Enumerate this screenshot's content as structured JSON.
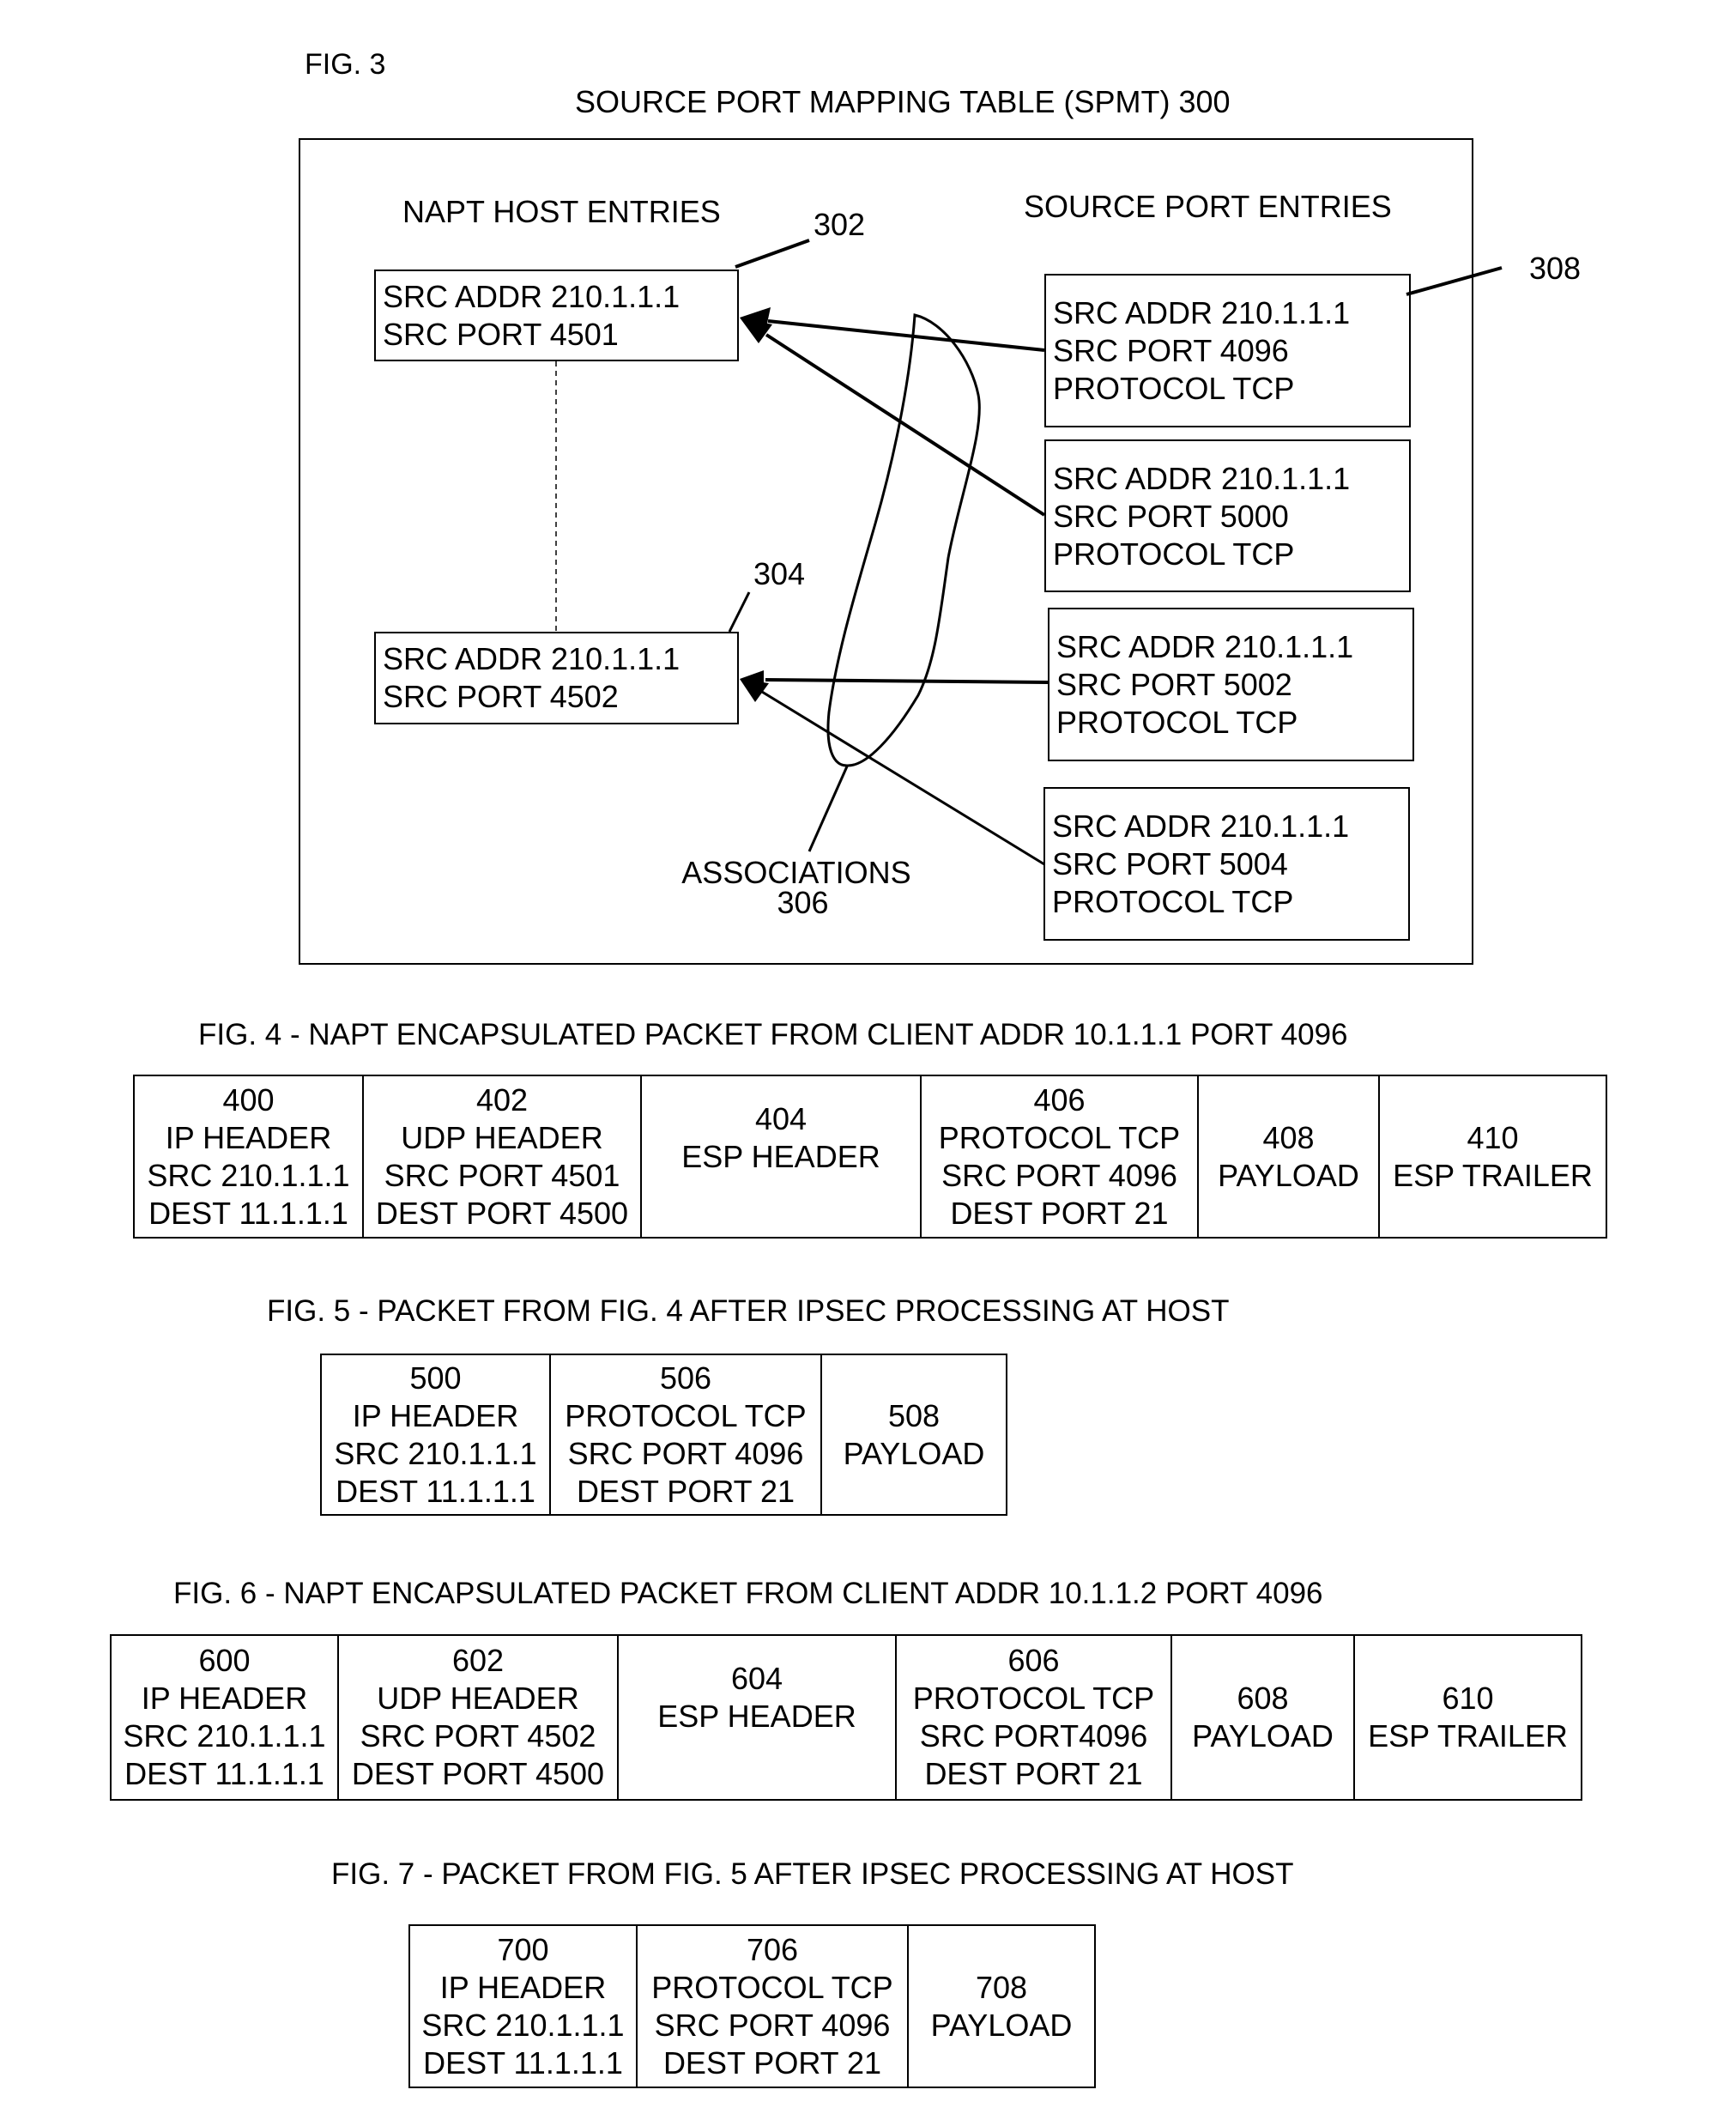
{
  "fig3": {
    "label": "FIG. 3",
    "title": "SOURCE PORT MAPPING TABLE  (SPMT) 300",
    "napt_heading": "NAPT HOST ENTRIES",
    "source_heading": "SOURCE PORT ENTRIES",
    "refs": {
      "host_entry_1": "302",
      "host_entry_2": "304",
      "associations_label": "ASSOCIATIONS",
      "associations_ref": "306",
      "source_entries": "308"
    },
    "host_entries": [
      {
        "ref": "302",
        "lines": [
          "SRC ADDR 210.1.1.1",
          "SRC PORT 4501"
        ]
      },
      {
        "ref": "304",
        "lines": [
          "SRC ADDR 210.1.1.1",
          "SRC PORT 4502"
        ]
      }
    ],
    "source_port_entries": [
      {
        "lines": [
          "SRC ADDR 210.1.1.1",
          "SRC PORT 4096",
          "PROTOCOL TCP"
        ],
        "maps_to": "302"
      },
      {
        "lines": [
          "SRC ADDR 210.1.1.1",
          "SRC PORT 5000",
          "PROTOCOL TCP"
        ],
        "maps_to": "302"
      },
      {
        "lines": [
          "SRC ADDR 210.1.1.1",
          "SRC PORT 5002",
          "PROTOCOL TCP"
        ],
        "maps_to": "304"
      },
      {
        "lines": [
          "SRC ADDR 210.1.1.1",
          "SRC PORT 5004",
          "PROTOCOL TCP"
        ],
        "maps_to": "304"
      }
    ]
  },
  "fig4": {
    "caption": "FIG. 4 - NAPT ENCAPSULATED PACKET FROM CLIENT ADDR 10.1.1.1  PORT 4096",
    "cells": [
      {
        "lines": [
          "400",
          "IP HEADER",
          "SRC 210.1.1.1",
          "DEST 11.1.1.1"
        ]
      },
      {
        "lines": [
          "402",
          "UDP HEADER",
          "SRC PORT 4501",
          "DEST PORT 4500"
        ]
      },
      {
        "lines": [
          "404",
          "ESP HEADER"
        ]
      },
      {
        "lines": [
          "406",
          "PROTOCOL TCP",
          "SRC PORT 4096",
          "DEST PORT 21"
        ]
      },
      {
        "lines": [
          "408",
          "PAYLOAD"
        ]
      },
      {
        "lines": [
          "410",
          "ESP TRAILER"
        ]
      }
    ]
  },
  "fig5": {
    "caption": "FIG. 5 -  PACKET FROM FIG. 4 AFTER IPSEC PROCESSING AT HOST",
    "cells": [
      {
        "lines": [
          "500",
          "IP HEADER",
          "SRC 210.1.1.1",
          "DEST 11.1.1.1"
        ]
      },
      {
        "lines": [
          "506",
          "PROTOCOL TCP",
          "SRC PORT 4096",
          "DEST PORT 21"
        ]
      },
      {
        "lines": [
          "508",
          "PAYLOAD"
        ]
      }
    ]
  },
  "fig6": {
    "caption": "FIG. 6 - NAPT ENCAPSULATED PACKET FROM CLIENT ADDR 10.1.1.2  PORT 4096",
    "cells": [
      {
        "lines": [
          "600",
          "IP HEADER",
          "SRC 210.1.1.1",
          "DEST 11.1.1.1"
        ]
      },
      {
        "lines": [
          "602",
          "UDP HEADER",
          "SRC PORT 4502",
          "DEST PORT 4500"
        ]
      },
      {
        "lines": [
          "604",
          "ESP HEADER"
        ]
      },
      {
        "lines": [
          "606",
          "PROTOCOL TCP",
          "SRC PORT4096",
          "DEST PORT 21"
        ]
      },
      {
        "lines": [
          "608",
          "PAYLOAD"
        ]
      },
      {
        "lines": [
          "610",
          "ESP TRAILER"
        ]
      }
    ]
  },
  "fig7": {
    "caption": "FIG. 7 -  PACKET FROM FIG. 5 AFTER IPSEC PROCESSING AT HOST",
    "cells": [
      {
        "lines": [
          "700",
          "IP HEADER",
          "SRC 210.1.1.1",
          "DEST 11.1.1.1"
        ]
      },
      {
        "lines": [
          "706",
          "PROTOCOL TCP",
          "SRC PORT 4096",
          "DEST PORT 21"
        ]
      },
      {
        "lines": [
          "708",
          "PAYLOAD"
        ]
      }
    ]
  }
}
